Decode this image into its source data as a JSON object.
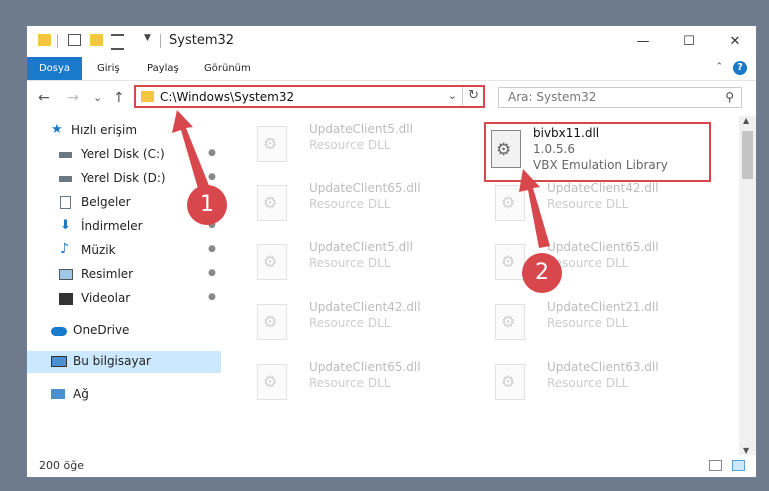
{
  "window": {
    "title": "System32",
    "controls": {
      "minimize": "—",
      "maximize": "☐",
      "close": "✕"
    }
  },
  "ribbon": {
    "tabs": [
      "Dosya",
      "Giriş",
      "Paylaş",
      "Görünüm"
    ],
    "help": "?",
    "collapse": "⌃"
  },
  "nav": {
    "back": "←",
    "forward": "→",
    "recent": "⌄",
    "up": "↑",
    "address": "C:\\Windows\\System32",
    "address_dropdown": "⌄",
    "refresh": "↻",
    "search_placeholder": "Ara: System32",
    "search_icon": "⚲"
  },
  "sidebar": {
    "items": [
      {
        "label": "Hızlı erişim",
        "icon": "star-icon",
        "pinned": false,
        "selected": false
      },
      {
        "label": "Yerel Disk (C:)",
        "icon": "drive-icon",
        "pinned": true,
        "selected": false
      },
      {
        "label": "Yerel Disk (D:)",
        "icon": "drive-icon",
        "pinned": true,
        "selected": false
      },
      {
        "label": "Belgeler",
        "icon": "documents-icon",
        "pinned": true,
        "selected": false
      },
      {
        "label": "İndirmeler",
        "icon": "downloads-icon",
        "pinned": true,
        "selected": false
      },
      {
        "label": "Müzik",
        "icon": "music-icon",
        "pinned": true,
        "selected": false
      },
      {
        "label": "Resimler",
        "icon": "pictures-icon",
        "pinned": true,
        "selected": false
      },
      {
        "label": "Videolar",
        "icon": "videos-icon",
        "pinned": true,
        "selected": false
      },
      {
        "label": "OneDrive",
        "icon": "cloud-icon",
        "pinned": false,
        "selected": false
      },
      {
        "label": "Bu bilgisayar",
        "icon": "computer-icon",
        "pinned": false,
        "selected": true
      },
      {
        "label": "Ağ",
        "icon": "network-icon",
        "pinned": false,
        "selected": false
      }
    ],
    "pin_glyph": "📌"
  },
  "files": {
    "tiles": [
      {
        "name": "UpdateClient5.dll",
        "type": "Resource DLL"
      },
      {
        "name": "UpdateClient65.dll",
        "type": "Resource DLL"
      },
      {
        "name": "UpdateClient42.dll",
        "type": "Resource DLL"
      },
      {
        "name": "UpdateClient5.dll",
        "type": "Resource DLL"
      },
      {
        "name": "UpdateClient65.dll",
        "type": "Resource DLL"
      },
      {
        "name": "UpdateClient42.dll",
        "type": "Resource DLL"
      },
      {
        "name": "UpdateClient21.dll",
        "type": "Resource DLL"
      },
      {
        "name": "UpdateClient65.dll",
        "type": "Resource DLL"
      },
      {
        "name": "UpdateClient63.dll",
        "type": "Resource DLL"
      }
    ],
    "highlighted": {
      "name": "bivbx11.dll",
      "version": "1.0.5.6",
      "description": "VBX Emulation Library"
    }
  },
  "status": {
    "count": "200 öğe"
  },
  "annotations": {
    "marker1": "1",
    "marker2": "2",
    "color": "#d8474b"
  },
  "colors": {
    "accent": "#1979ca",
    "highlight": "#d8474b",
    "selection": "#cce8ff"
  }
}
